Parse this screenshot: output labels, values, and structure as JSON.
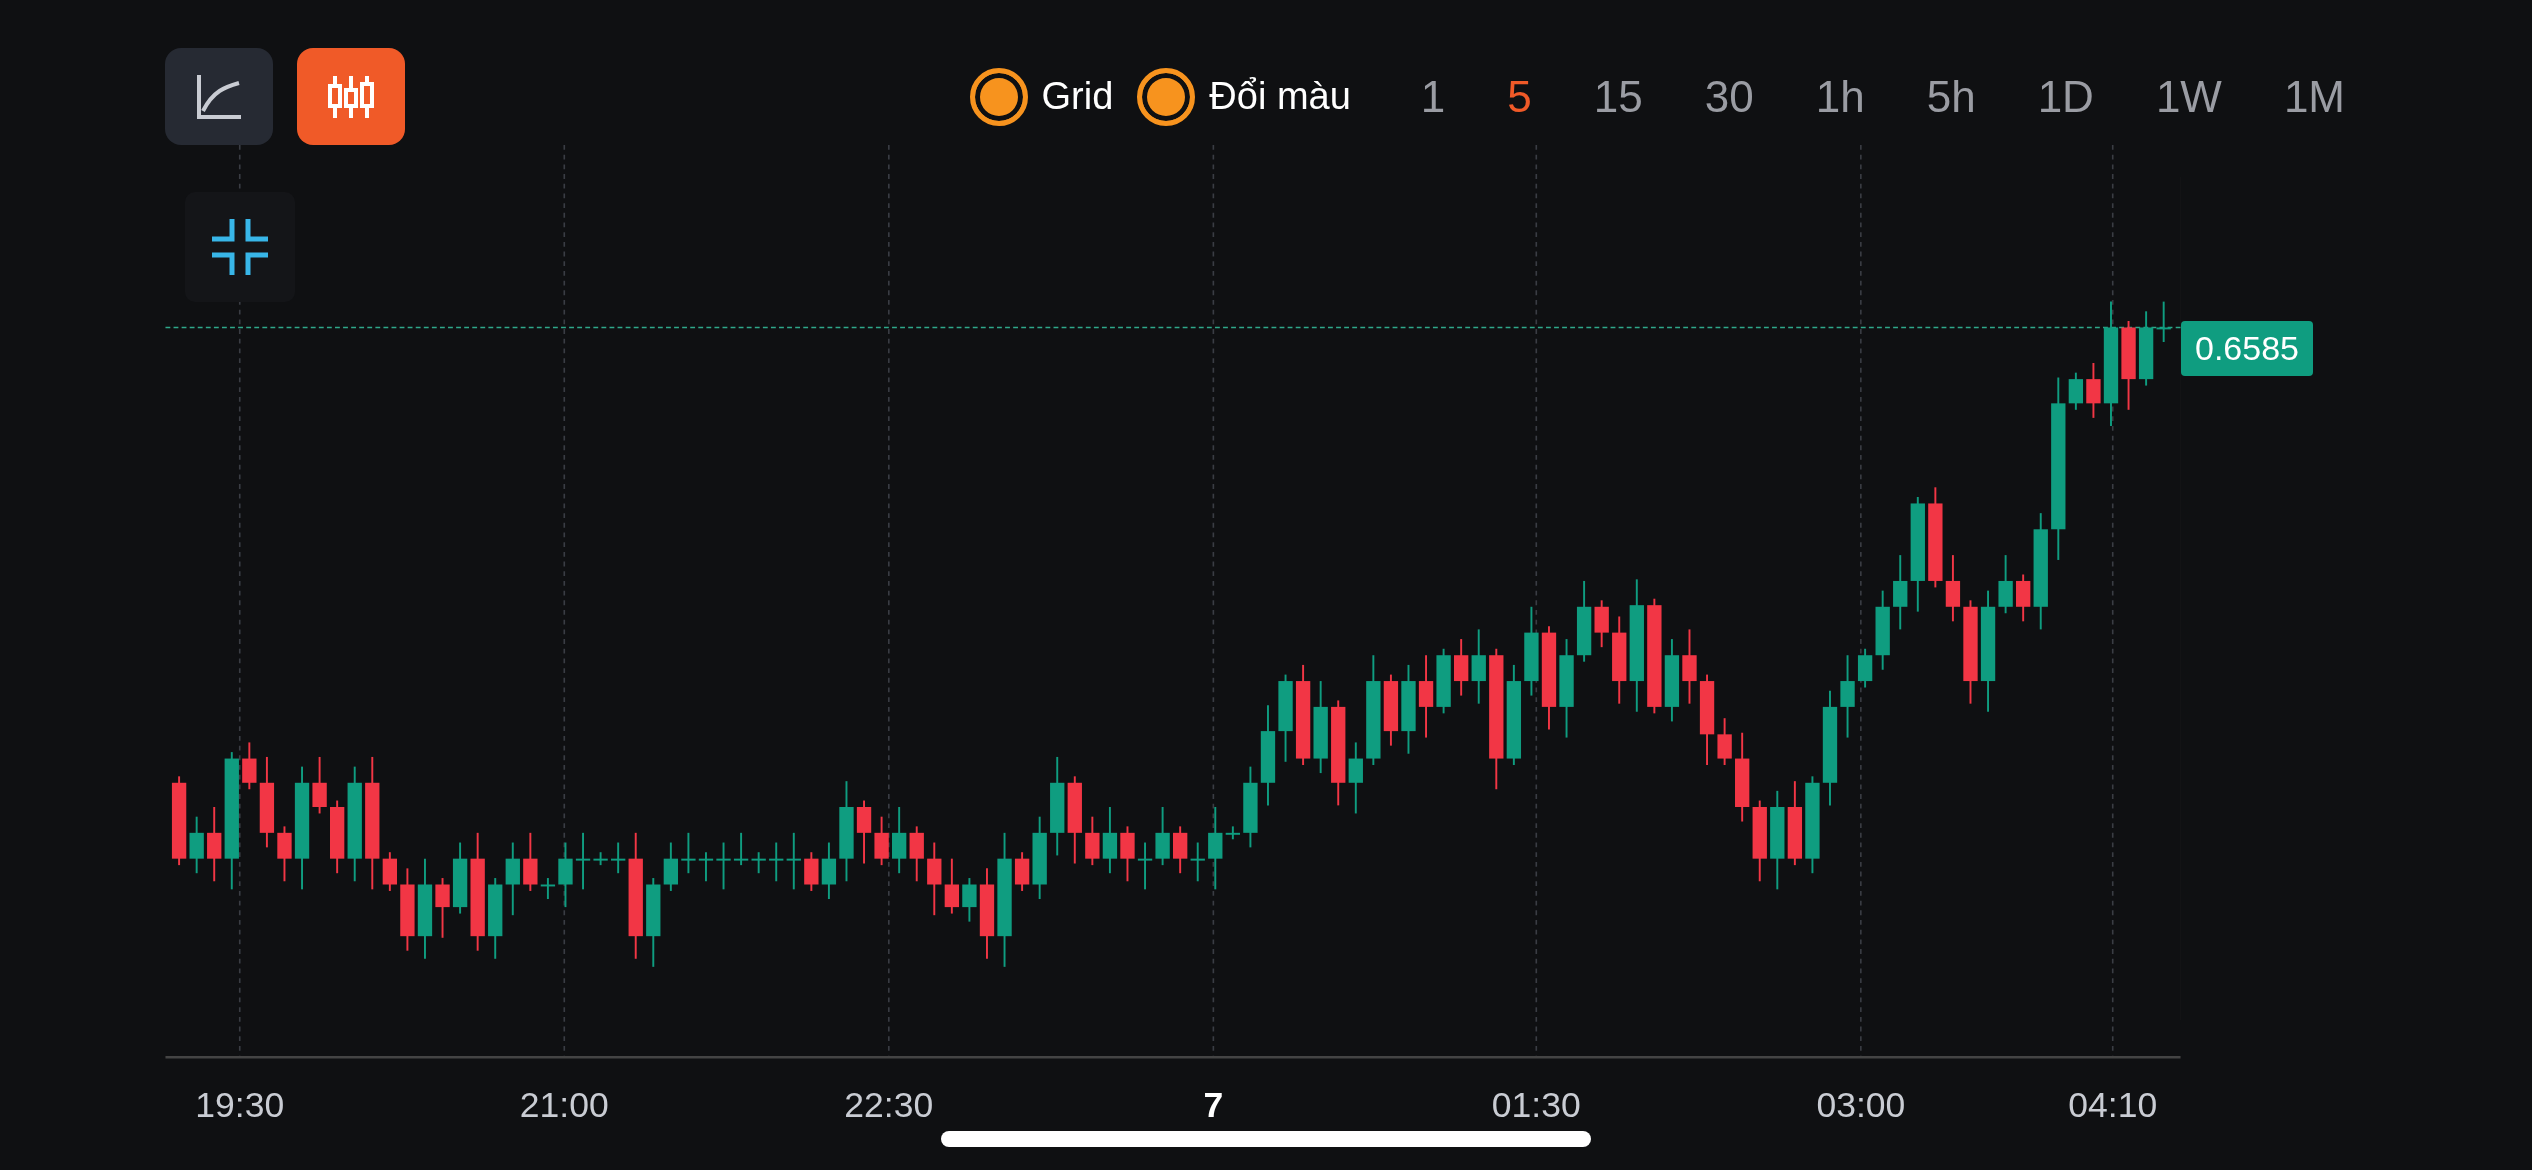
{
  "chart_types": [
    {
      "kind": "line",
      "selected": false
    },
    {
      "kind": "candles",
      "selected": true
    }
  ],
  "toggles": [
    {
      "label": "Grid",
      "on": true
    },
    {
      "label": "Đổi màu",
      "on": true
    }
  ],
  "intervals": [
    {
      "label": "1",
      "selected": false
    },
    {
      "label": "5",
      "selected": true
    },
    {
      "label": "15",
      "selected": false
    },
    {
      "label": "30",
      "selected": false
    },
    {
      "label": "1h",
      "selected": false
    },
    {
      "label": "5h",
      "selected": false
    },
    {
      "label": "1D",
      "selected": false
    },
    {
      "label": "1W",
      "selected": false
    },
    {
      "label": "1M",
      "selected": false
    }
  ],
  "price_label": "0.6585",
  "time_axis": [
    {
      "label": "19:30",
      "kind": "time"
    },
    {
      "label": "21:00",
      "kind": "time"
    },
    {
      "label": "22:30",
      "kind": "time"
    },
    {
      "label": "7",
      "kind": "day"
    },
    {
      "label": "01:30",
      "kind": "time"
    },
    {
      "label": "03:00",
      "kind": "time"
    },
    {
      "label": "04:10",
      "kind": "time"
    }
  ]
}
